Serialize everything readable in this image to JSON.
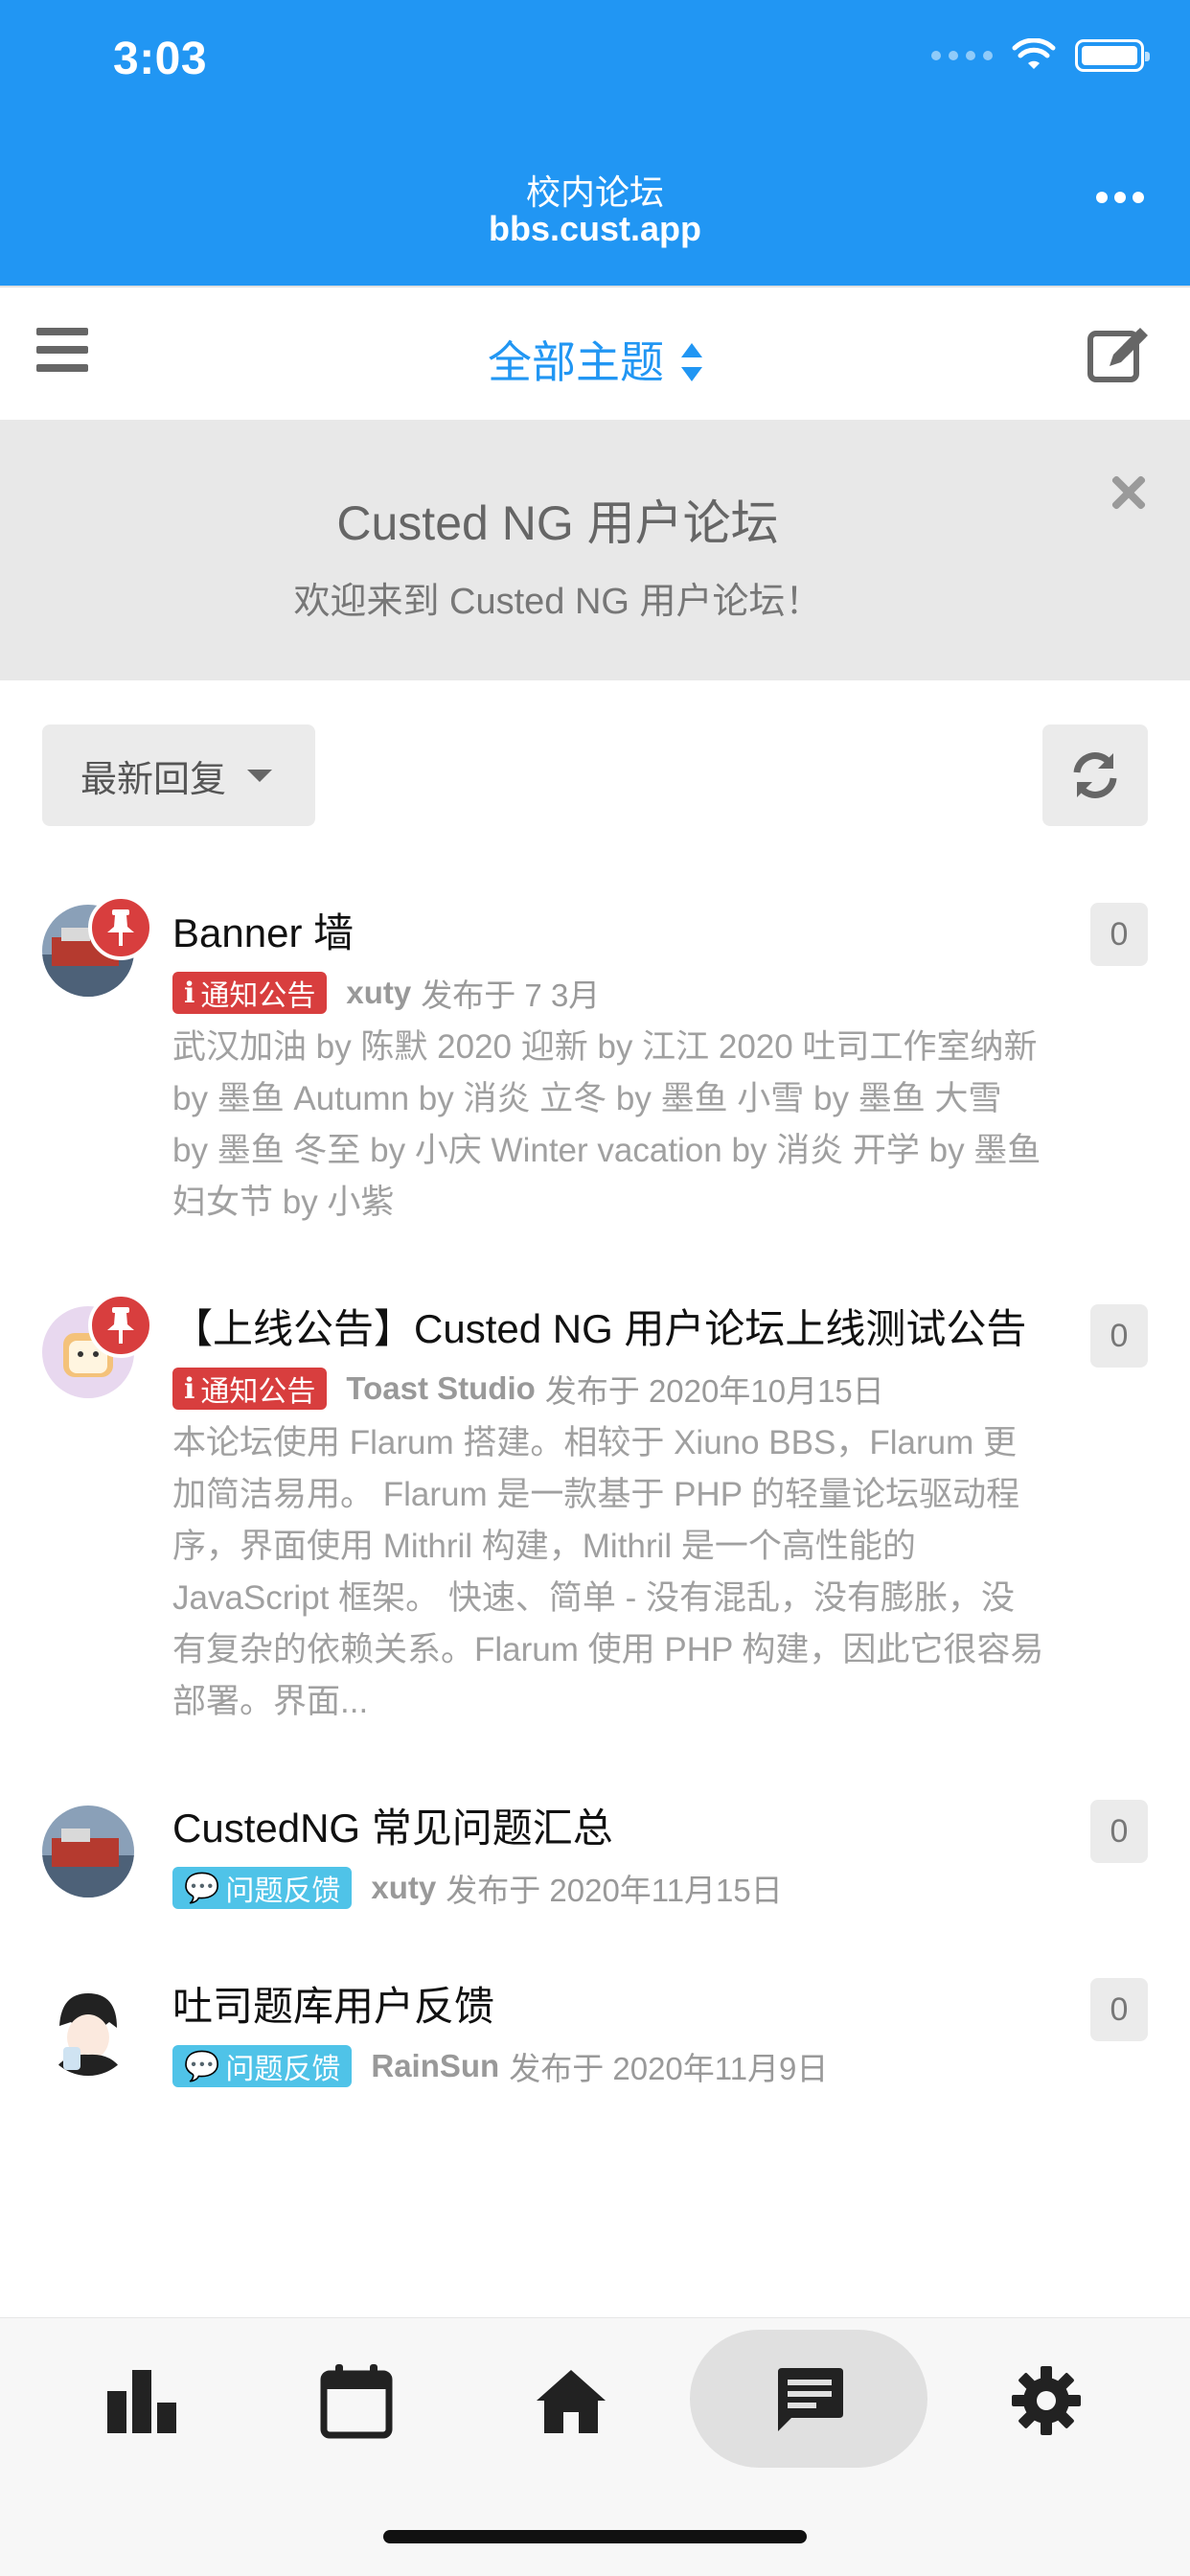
{
  "status_bar": {
    "time": "3:03"
  },
  "header": {
    "title": "校内论坛",
    "url": "bbs.cust.app"
  },
  "toolbar": {
    "title": "全部主题"
  },
  "hero": {
    "title": "Custed NG 用户论坛",
    "subtitle": "欢迎来到 Custed NG 用户论坛！"
  },
  "controls": {
    "sort_label": "最新回复"
  },
  "discussions": [
    {
      "title": "Banner 墙",
      "tag": "通知公告",
      "tag_color": "#d83e3e",
      "author": "xuty",
      "posted": "发布于 7 3月",
      "excerpt": "武汉加油 by 陈默 2020 迎新 by 江江 2020 吐司工作室纳新 by 墨鱼 Autumn by 消炎 立冬 by 墨鱼 小雪 by 墨鱼 大雪 by 墨鱼 冬至 by 小庆 Winter vacation by 消炎 开学 by 墨鱼 妇女节 by 小紫",
      "replies": "0",
      "pinned": true
    },
    {
      "title": "【上线公告】Custed NG 用户论坛上线测试公告",
      "tag": "通知公告",
      "tag_color": "#d83e3e",
      "author": "Toast Studio",
      "posted": "发布于 2020年10月15日",
      "excerpt": "本论坛使用 Flarum 搭建。相较于 Xiuno BBS，Flarum 更加简洁易用。 Flarum 是一款基于 PHP 的轻量论坛驱动程序，界面使用 Mithril 构建，Mithril 是一个高性能的 JavaScript 框架。 快速、简单 - 没有混乱，没有膨胀，没有复杂的依赖关系。Flarum 使用 PHP 构建，因此它很容易部署。界面...",
      "replies": "0",
      "pinned": true
    },
    {
      "title": "CustedNG 常见问题汇总",
      "tag": "问题反馈",
      "tag_color": "#4fc3e8",
      "author": "xuty",
      "posted": "发布于 2020年11月15日",
      "replies": "0",
      "pinned": false
    },
    {
      "title": "吐司题库用户反馈",
      "tag": "问题反馈",
      "tag_color": "#4fc3e8",
      "author": "RainSun",
      "posted": "发布于 2020年11月9日",
      "replies": "0",
      "pinned": false
    }
  ],
  "bottom_nav": {
    "items": [
      "chart-bar-icon",
      "calendar-icon",
      "home-icon",
      "comment-icon",
      "gear-icon"
    ],
    "active": "comment-icon"
  },
  "colors": {
    "primary": "#2196F3",
    "notice_tag": "#d83e3e",
    "feedback_tag": "#4fc3e8"
  }
}
